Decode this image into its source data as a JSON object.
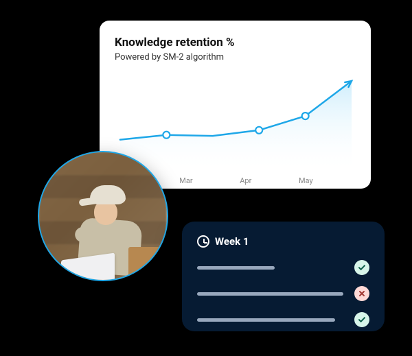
{
  "chart": {
    "title": "Knowledge retention %",
    "subtitle": "Powered by SM-2 algorithm",
    "x_labels": [
      "Mar",
      "Apr",
      "May"
    ]
  },
  "chart_data": {
    "type": "line",
    "title": "Knowledge retention %",
    "xlabel": "",
    "ylabel": "",
    "x": [
      0,
      1,
      2,
      3,
      4,
      5
    ],
    "values": [
      30,
      35,
      34,
      40,
      55,
      92
    ],
    "markers_at_x": [
      1,
      3,
      4
    ],
    "x_tick_labels": {
      "1": "Mar",
      "3": "Apr",
      "4": "May"
    },
    "ylim": [
      0,
      100
    ],
    "area_fill": true,
    "line_color": "#1ea7e8"
  },
  "avatar": {
    "alt": "Worker in warehouse using laptop"
  },
  "week": {
    "title": "Week 1",
    "rows": [
      {
        "bar_width_pct": 45,
        "status": "check"
      },
      {
        "bar_width_pct": 85,
        "status": "fail"
      },
      {
        "bar_width_pct": 80,
        "status": "check"
      }
    ]
  },
  "colors": {
    "accent": "#1ea7e8",
    "dark": "#061b33",
    "check_bg": "#d7f5e9",
    "check_fg": "#0b5c47",
    "fail_bg": "#ffd9d6",
    "fail_fg": "#a33a34"
  }
}
